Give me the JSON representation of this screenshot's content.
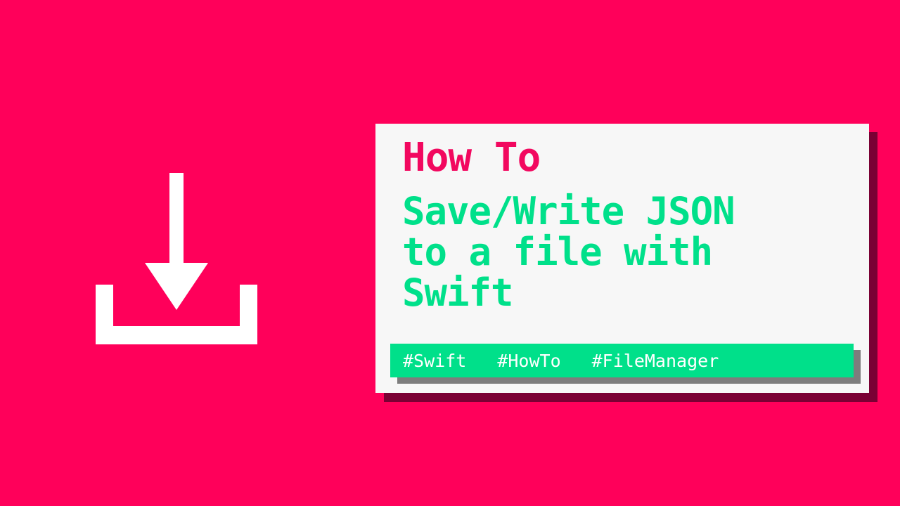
{
  "icon": "download-icon",
  "colors": {
    "background": "#ff005a",
    "accent_pink": "#f2085f",
    "accent_green": "#00e08a",
    "card": "#f7f7f7"
  },
  "card": {
    "kicker": "How To",
    "title_lines": [
      "Save/Write JSON",
      "to a file with",
      "Swift"
    ],
    "tags": [
      "#Swift",
      "#HowTo",
      "#FileManager"
    ]
  }
}
